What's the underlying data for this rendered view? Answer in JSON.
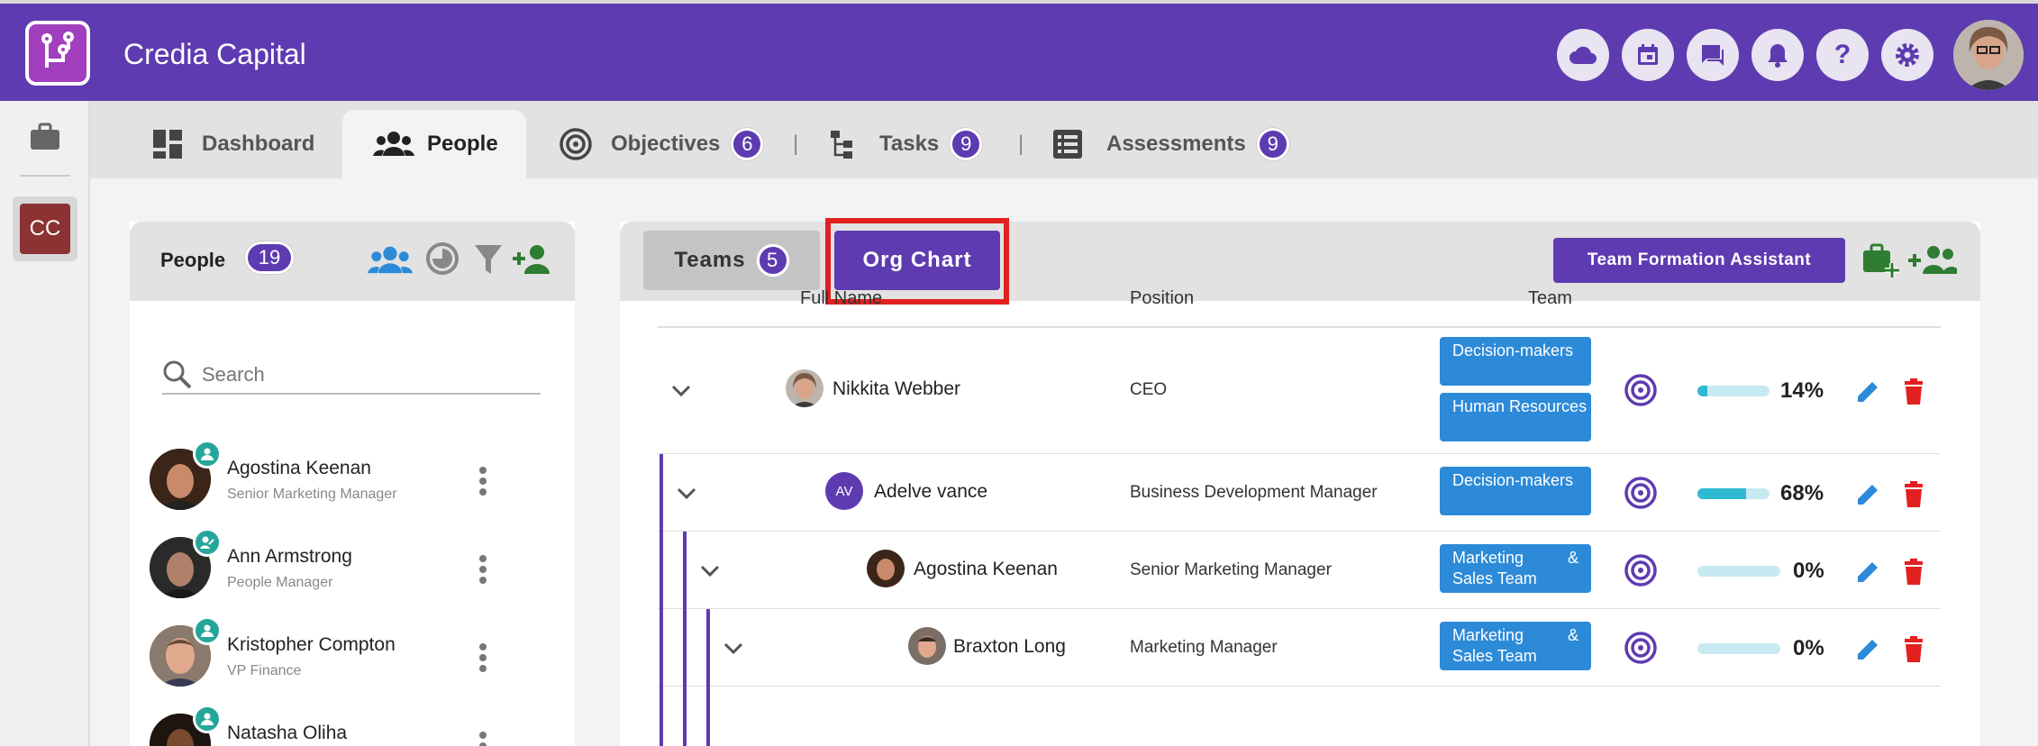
{
  "app": {
    "title": "Credia Capital"
  },
  "colors": {
    "brand": "#5e3bb0",
    "team_pill": "#2c8ad8",
    "delete": "#e32020",
    "edit": "#2c8ad8"
  },
  "topbar_icons": [
    "cloud-icon",
    "calendar-icon",
    "chat-icon",
    "bell-icon",
    "help-icon",
    "gear-icon"
  ],
  "left_rail": {
    "org_initials": "CC"
  },
  "nav_tabs": [
    {
      "label": "Dashboard",
      "badge": ""
    },
    {
      "label": "People",
      "badge": ""
    },
    {
      "label": "Objectives",
      "badge": "6"
    },
    {
      "label": "Tasks",
      "badge": "9"
    },
    {
      "label": "Assessments",
      "badge": "9"
    }
  ],
  "nav_separator": "|",
  "people_panel": {
    "title": "People",
    "count": "19",
    "search_placeholder": "Search",
    "people": [
      {
        "name": "Agostina Keenan",
        "role": "Senior Marketing Manager"
      },
      {
        "name": "Ann Armstrong",
        "role": "People Manager"
      },
      {
        "name": "Kristopher Compton",
        "role": "VP Finance"
      },
      {
        "name": "Natasha Oliha",
        "role": ""
      }
    ]
  },
  "main_panel": {
    "teams_tab": {
      "label": "Teams",
      "count": "5"
    },
    "org_tab": {
      "label": "Org Chart"
    },
    "team_formation_button": "Team Formation Assistant",
    "columns": {
      "full_name": "Full Name",
      "position": "Position",
      "team": "Team"
    },
    "rows": [
      {
        "name": "Nikkita Webber",
        "position": "CEO",
        "teams": [
          "Decision-makers",
          "Human Resources"
        ],
        "progress": 14,
        "progress_label": "14%"
      },
      {
        "name": "Adelve vance",
        "initials": "AV",
        "position": "Business Development Manager",
        "teams": [
          "Decision-makers"
        ],
        "progress": 68,
        "progress_label": "68%"
      },
      {
        "name": "Agostina Keenan",
        "position": "Senior Marketing Manager",
        "teams": [
          "Marketing & Sales Team"
        ],
        "progress": 0,
        "progress_label": "0%"
      },
      {
        "name": "Braxton Long",
        "position": "Marketing Manager",
        "teams": [
          "Marketing & Sales Team"
        ],
        "progress": 0,
        "progress_label": "0%"
      }
    ]
  }
}
